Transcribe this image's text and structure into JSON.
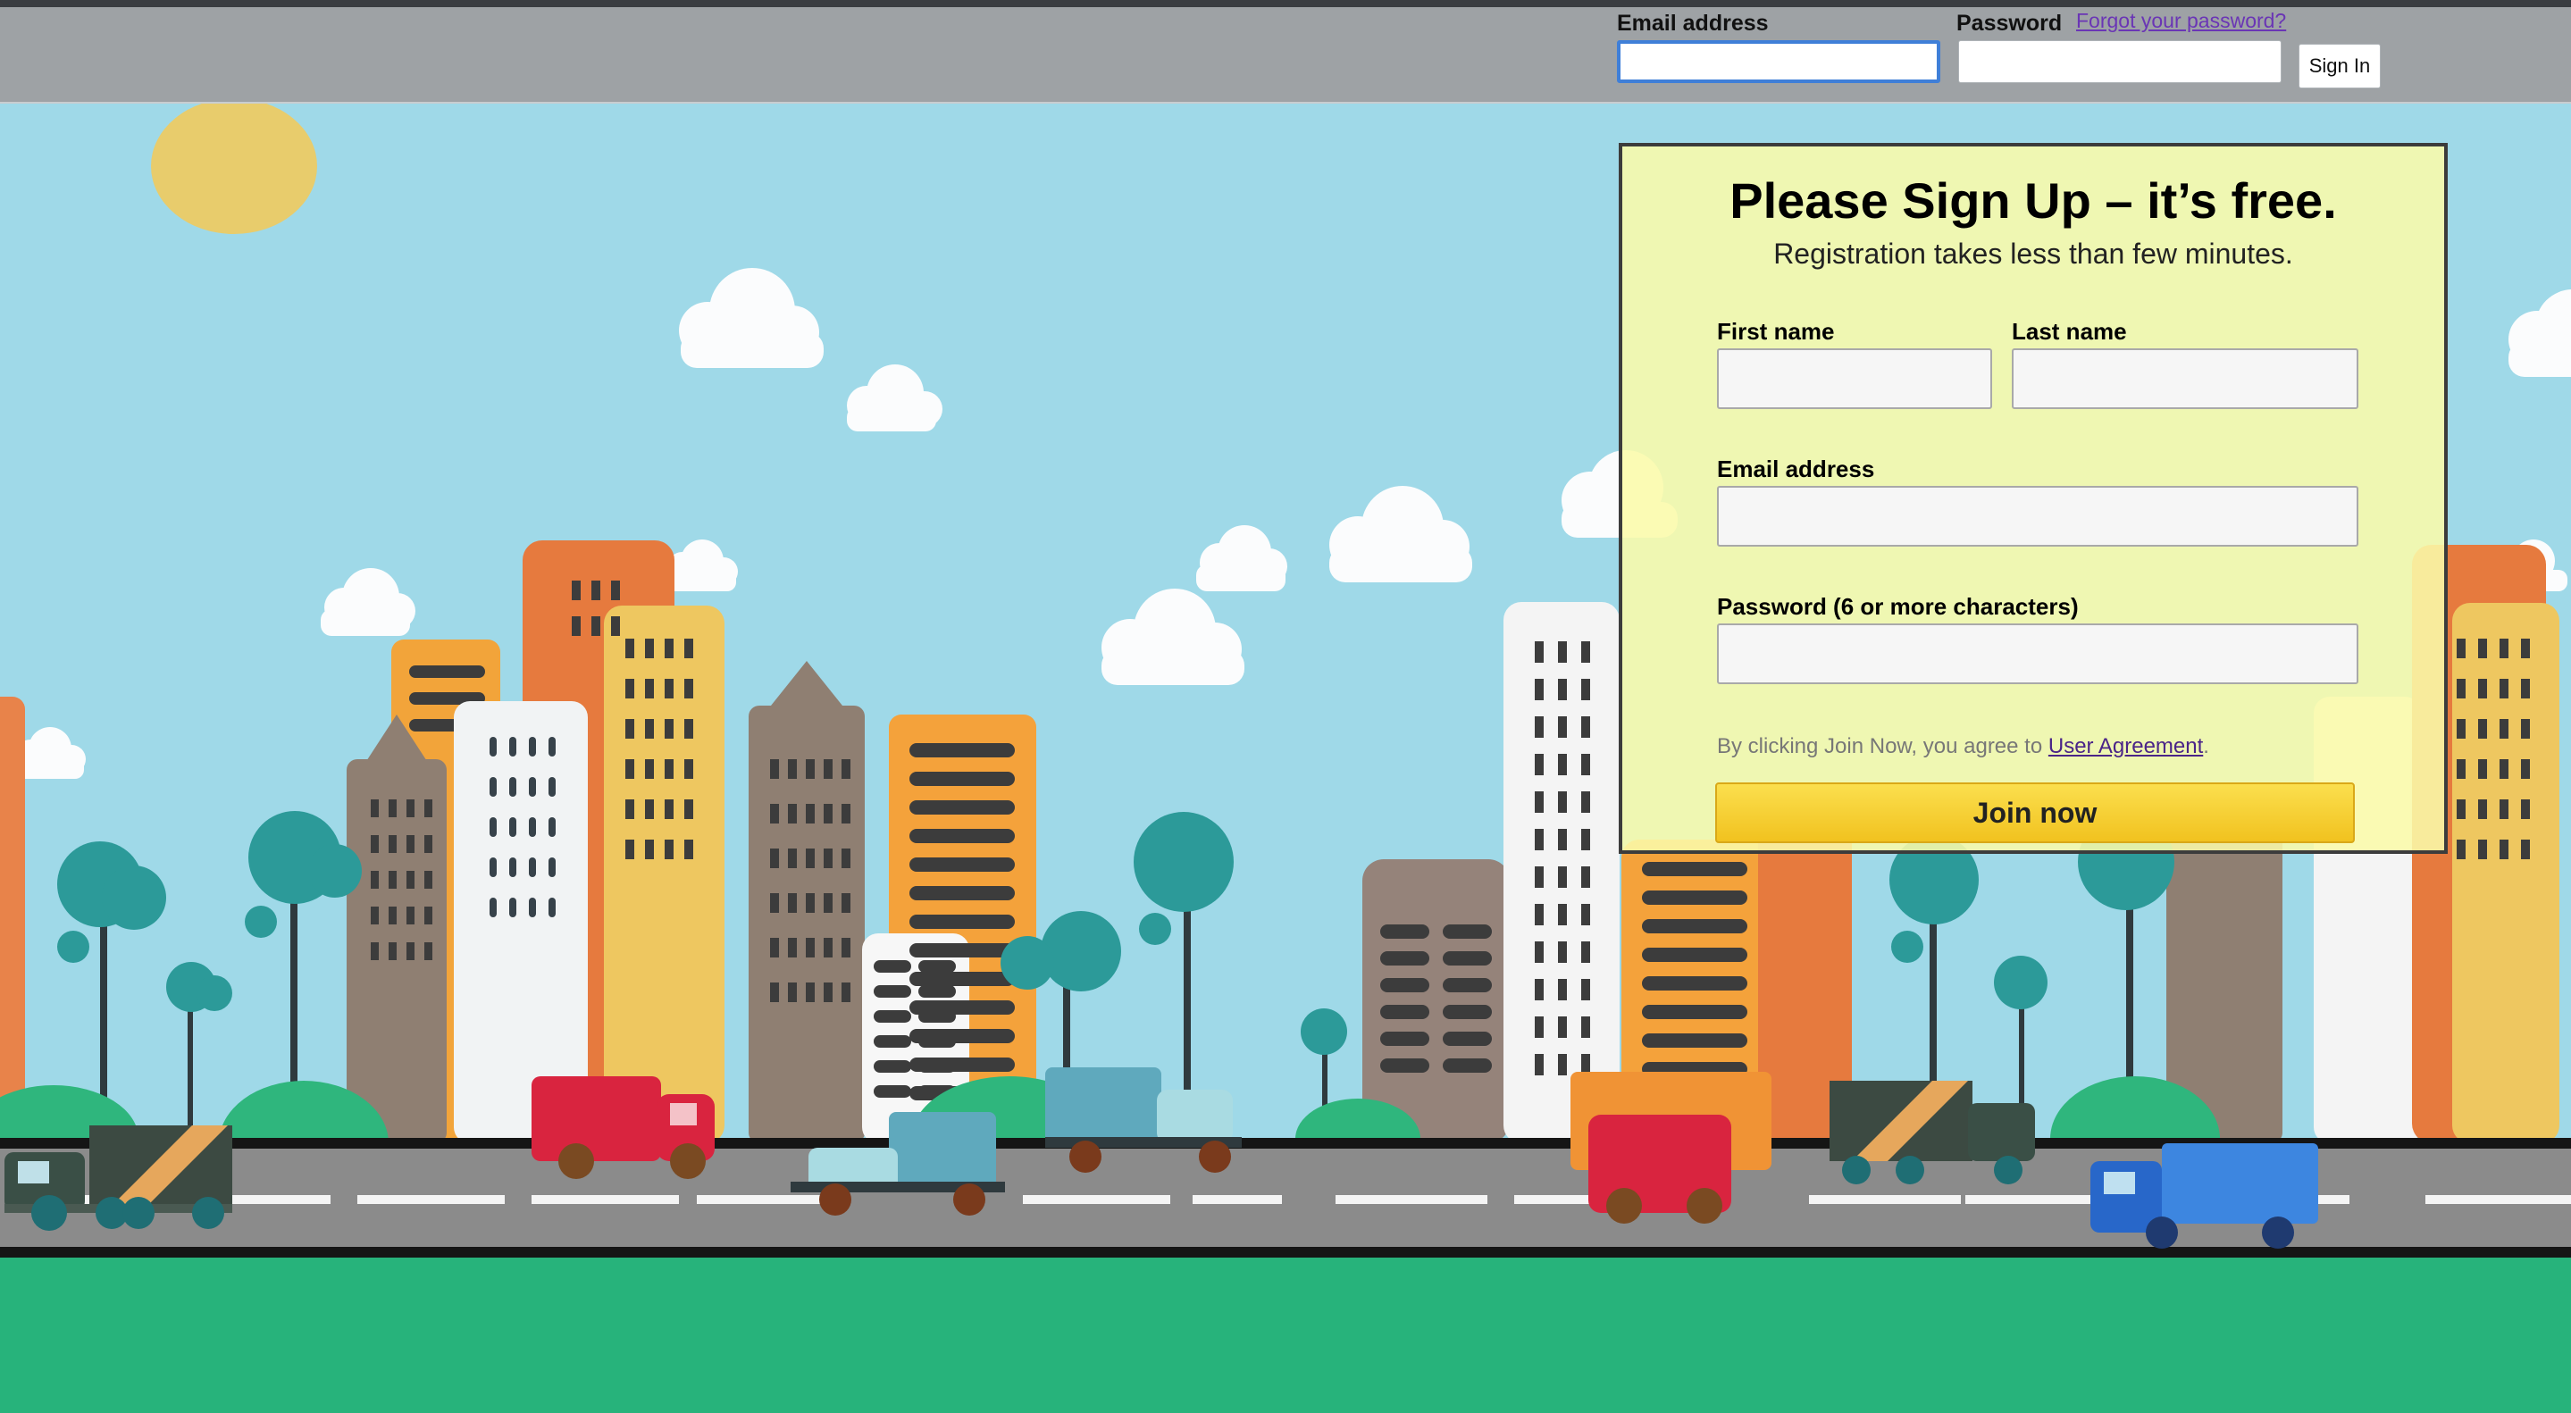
{
  "header": {
    "email_label": "Email address",
    "password_label": "Password",
    "forgot_link": "Forgot your password?",
    "signin_button": "Sign In",
    "email_value": "",
    "password_value": ""
  },
  "signup": {
    "title": "Please Sign Up – it’s free.",
    "subtitle": "Registration takes less than few minutes.",
    "first_name_label": "First name",
    "last_name_label": "Last name",
    "email_label": "Email address",
    "password_label": "Password (6 or more characters)",
    "agreement_prefix": "By clicking Join Now, you agree to ",
    "agreement_link": "User Agreement",
    "agreement_suffix": ".",
    "join_button": "Join now"
  },
  "colors": {
    "header_bg": "#9ea2a5",
    "sky": "#9fd9e8",
    "panel": "#f8f8a8",
    "join_button": "#f5cf2c",
    "ground": "#27b37b",
    "road": "#8b8b8b"
  }
}
